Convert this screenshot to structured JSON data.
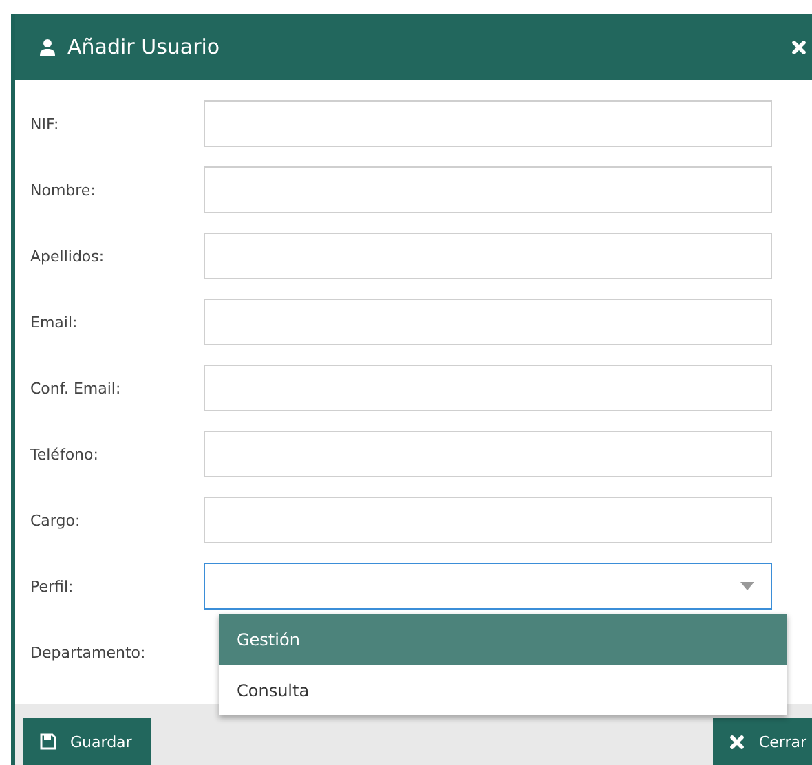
{
  "dialog": {
    "title": "Añadir Usuario"
  },
  "fields": [
    {
      "label": "NIF:",
      "kind": "text"
    },
    {
      "label": "Nombre:",
      "kind": "text"
    },
    {
      "label": "Apellidos:",
      "kind": "text"
    },
    {
      "label": "Email:",
      "kind": "text"
    },
    {
      "label": "Conf. Email:",
      "kind": "text"
    },
    {
      "label": "Teléfono:",
      "kind": "text"
    },
    {
      "label": "Cargo:",
      "kind": "text"
    },
    {
      "label": "Perfil:",
      "kind": "select",
      "focused": true,
      "open": true,
      "options": [
        {
          "label": "Gestión",
          "selected": true
        },
        {
          "label": "Consulta",
          "selected": false
        }
      ]
    },
    {
      "label": "Departamento:",
      "kind": "covered"
    }
  ],
  "buttons": [
    {
      "label": "Guardar",
      "kind": "save"
    },
    {
      "label": "Cerrar",
      "kind": "close"
    }
  ]
}
